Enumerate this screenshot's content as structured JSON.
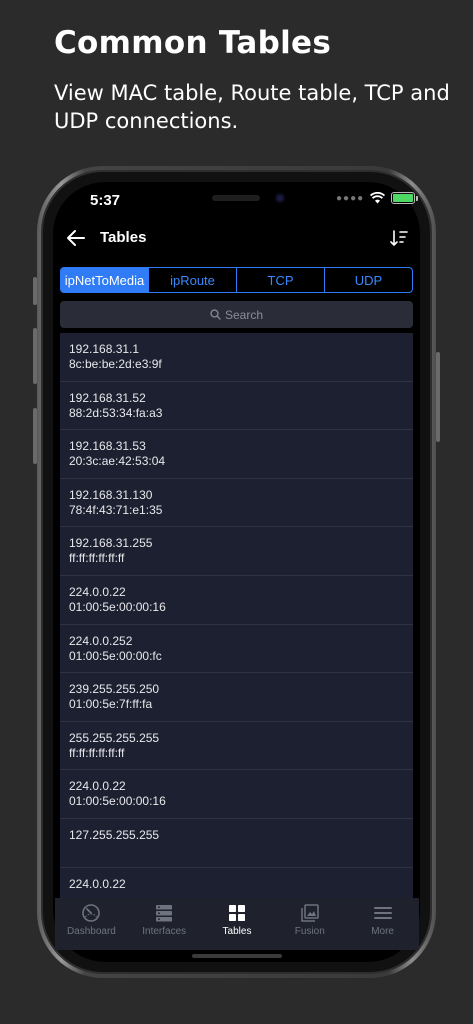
{
  "promo": {
    "title": "Common Tables",
    "subtitle": "View MAC table, Route table, TCP and UDP connections."
  },
  "status_bar": {
    "time": "5:37"
  },
  "header": {
    "title": "Tables"
  },
  "segments": [
    {
      "label": "ipNetToMedia",
      "active": true
    },
    {
      "label": "ipRoute",
      "active": false
    },
    {
      "label": "TCP",
      "active": false
    },
    {
      "label": "UDP",
      "active": false
    }
  ],
  "search": {
    "placeholder": "Search"
  },
  "rows": [
    {
      "ip": "192.168.31.1",
      "mac": "8c:be:be:2d:e3:9f"
    },
    {
      "ip": "192.168.31.52",
      "mac": "88:2d:53:34:fa:a3"
    },
    {
      "ip": "192.168.31.53",
      "mac": "20:3c:ae:42:53:04"
    },
    {
      "ip": "192.168.31.130",
      "mac": "78:4f:43:71:e1:35"
    },
    {
      "ip": "192.168.31.255",
      "mac": "ff:ff:ff:ff:ff:ff"
    },
    {
      "ip": "224.0.0.22",
      "mac": "01:00:5e:00:00:16"
    },
    {
      "ip": "224.0.0.252",
      "mac": "01:00:5e:00:00:fc"
    },
    {
      "ip": "239.255.255.250",
      "mac": "01:00:5e:7f:ff:fa"
    },
    {
      "ip": "255.255.255.255",
      "mac": "ff:ff:ff:ff:ff:ff"
    },
    {
      "ip": "224.0.0.22",
      "mac": "01:00:5e:00:00:16"
    },
    {
      "ip": "127.255.255.255",
      "mac": ""
    },
    {
      "ip": "224.0.0.22",
      "mac": ""
    }
  ],
  "tabbar": [
    {
      "label": "Dashboard",
      "icon": "dashboard-icon",
      "active": false
    },
    {
      "label": "Interfaces",
      "icon": "interfaces-icon",
      "active": false
    },
    {
      "label": "Tables",
      "icon": "tables-icon",
      "active": true
    },
    {
      "label": "Fusion",
      "icon": "fusion-icon",
      "active": false
    },
    {
      "label": "More",
      "icon": "more-icon",
      "active": false
    }
  ],
  "colors": {
    "accent": "#2f7cf6",
    "list_bg": "#1d2030",
    "page_bg": "#2b2b2b",
    "battery": "#4cd964"
  }
}
